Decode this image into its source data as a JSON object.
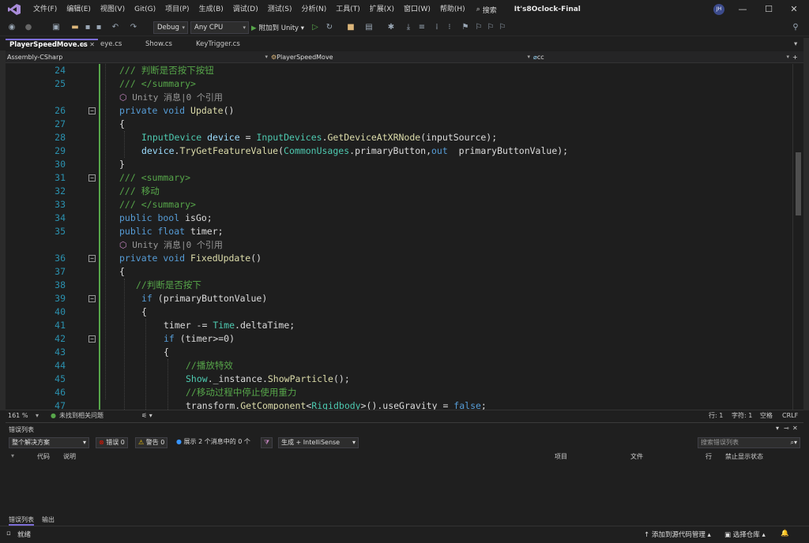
{
  "menu": [
    "文件(F)",
    "编辑(E)",
    "视图(V)",
    "Git(G)",
    "项目(P)",
    "生成(B)",
    "调试(D)",
    "测试(S)",
    "分析(N)",
    "工具(T)",
    "扩展(X)",
    "窗口(W)",
    "帮助(H)"
  ],
  "search_label": "搜索",
  "app_name": "It's8Oclock-Final",
  "user_initials": "JH",
  "toolbar": {
    "config": "Debug",
    "platform": "Any CPU",
    "attach": "附加到 Unity"
  },
  "tabs": [
    {
      "label": "PlayerSpeedMove.cs",
      "active": true
    },
    {
      "label": "eye.cs",
      "active": false
    },
    {
      "label": "Show.cs",
      "active": false
    },
    {
      "label": "KeyTrigger.cs",
      "active": false
    }
  ],
  "nav": {
    "project": "Assembly-CSharp",
    "class": "PlayerSpeedMove",
    "member": "cc"
  },
  "code_lines": [
    {
      "n": "24",
      "indent": 0,
      "html": "<span class='cm'>/// 判断是否按下按钮</span>"
    },
    {
      "n": "25",
      "indent": 0,
      "html": "<span class='cm'>/// &lt;/summary&gt;</span>"
    },
    {
      "n": "",
      "lens": "Unity 消息|0 个引用"
    },
    {
      "n": "26",
      "indent": 0,
      "fold": true,
      "html": "<span class='kw'>private void</span> <span class='mt'>Update</span><span class='pl'>()</span>"
    },
    {
      "n": "27",
      "indent": 0,
      "html": "<span class='pl'>{</span>"
    },
    {
      "n": "28",
      "indent": 1,
      "html": "<span class='ty'>InputDevice</span> <span class='id'>device</span> <span class='pl'>=</span> <span class='ty'>InputDevices</span><span class='pl'>.</span><span class='mt'>GetDeviceAtXRNode</span><span class='pl'>(inputSource);</span>"
    },
    {
      "n": "29",
      "indent": 1,
      "html": "<span class='id'>device</span><span class='pl'>.</span><span class='mt'>TryGetFeatureValue</span><span class='pl'>(</span><span class='ty'>CommonUsages</span><span class='pl'>.primaryButton,</span><span class='kw'>out</span><span class='pl'>  primaryButtonValue);</span>"
    },
    {
      "n": "30",
      "indent": 0,
      "html": "<span class='pl'>}</span>"
    },
    {
      "n": "31",
      "indent": 0,
      "fold": true,
      "html": "<span class='cm'>/// &lt;summary&gt;</span>"
    },
    {
      "n": "32",
      "indent": 0,
      "html": "<span class='cm'>/// 移动</span>"
    },
    {
      "n": "33",
      "indent": 0,
      "html": "<span class='cm'>/// &lt;/summary&gt;</span>"
    },
    {
      "n": "34",
      "indent": 0,
      "html": "<span class='kw'>public bool</span> <span class='pl'>isGo;</span>"
    },
    {
      "n": "35",
      "indent": 0,
      "html": "<span class='kw'>public float</span> <span class='pl'>timer;</span>"
    },
    {
      "n": "",
      "lens": "Unity 消息|0 个引用"
    },
    {
      "n": "36",
      "indent": 0,
      "fold": true,
      "html": "<span class='kw'>private void</span> <span class='mt'>FixedUpdate</span><span class='pl'>()</span>"
    },
    {
      "n": "37",
      "indent": 0,
      "html": "<span class='pl'>{</span>"
    },
    {
      "n": "38",
      "indent": 0.75,
      "html": "<span class='cm'>//判断是否按下</span>"
    },
    {
      "n": "39",
      "indent": 1,
      "fold": true,
      "html": "<span class='kw'>if</span> <span class='pl'>(primaryButtonValue)</span>"
    },
    {
      "n": "40",
      "indent": 1,
      "html": "<span class='pl'>{</span>"
    },
    {
      "n": "41",
      "indent": 2,
      "html": "<span class='pl'>timer -= </span><span class='ty'>Time</span><span class='pl'>.deltaTime;</span>"
    },
    {
      "n": "42",
      "indent": 2,
      "fold": true,
      "html": "<span class='kw'>if</span> <span class='pl'>(timer&gt;=0)</span>"
    },
    {
      "n": "43",
      "indent": 2,
      "html": "<span class='pl'>{</span>"
    },
    {
      "n": "44",
      "indent": 3,
      "html": "<span class='cm'>//播放特效</span>"
    },
    {
      "n": "45",
      "indent": 3,
      "html": "<span class='ty'>Show</span><span class='pl'>._instance.</span><span class='mt'>ShowParticle</span><span class='pl'>();</span>"
    },
    {
      "n": "46",
      "indent": 3,
      "html": "<span class='cm'>//移动过程中停止使用重力</span>"
    },
    {
      "n": "47",
      "indent": 3,
      "html": "<span class='pl'>transform.</span><span class='mt'>GetComponent</span><span class='pl'>&lt;</span><span class='ty'>Rigidbody</span><span class='pl'>&gt;().useGravity = </span><span class='kw'>false</span><span class='pl'>;</span>"
    }
  ],
  "editor_status": {
    "zoom": "161 %",
    "issues": "未找到相关问题",
    "line": "行: 1",
    "char": "字符: 1",
    "ws": "空格",
    "eol": "CRLF"
  },
  "error_list": {
    "title": "错误列表",
    "scope": "整个解决方案",
    "errors": "错误 0",
    "warnings": "警告 0",
    "messages": "展示 2 个消息中的 0 个",
    "source": "生成 + IntelliSense",
    "search_placeholder": "搜索错误列表",
    "columns": [
      "代码",
      "说明",
      "项目",
      "文件",
      "行",
      "禁止显示状态"
    ],
    "bottom_tabs": [
      "错误列表",
      "输出"
    ]
  },
  "status": {
    "ready": "就绪",
    "scm": "添加到源代码管理",
    "repo": "选择仓库"
  },
  "colors": {
    "accent": "#7c6dd6",
    "keyword": "#569cd6",
    "type": "#4ec9b0",
    "comment": "#57a64a",
    "method": "#dcdcaa",
    "line_number": "#2b91af"
  }
}
